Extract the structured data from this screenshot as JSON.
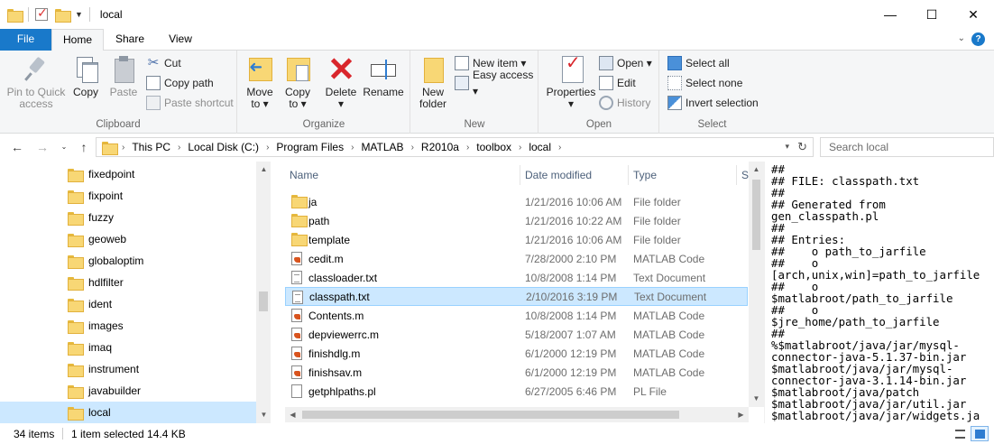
{
  "window": {
    "title": "local",
    "controls": {
      "minimize": "—",
      "maximize": "☐",
      "close": "✕"
    }
  },
  "ribbon": {
    "tabs": [
      "File",
      "Home",
      "Share",
      "View"
    ],
    "active_tab": "Home",
    "help": "?",
    "clipboard": {
      "label": "Clipboard",
      "pin": [
        "Pin to Quick",
        "access"
      ],
      "copy": "Copy",
      "paste": "Paste",
      "cut": "Cut",
      "copy_path": "Copy path",
      "paste_shortcut": "Paste shortcut"
    },
    "organize": {
      "label": "Organize",
      "move_to": [
        "Move",
        "to ▾"
      ],
      "copy_to": [
        "Copy",
        "to ▾"
      ],
      "delete": [
        "Delete",
        "▾"
      ],
      "rename": "Rename"
    },
    "new": {
      "label": "New",
      "new_folder": [
        "New",
        "folder"
      ],
      "new_item": "New item ▾",
      "easy_access": "Easy access ▾"
    },
    "open": {
      "label": "Open",
      "properties": [
        "Properties",
        "▾"
      ],
      "open": "Open ▾",
      "edit": "Edit",
      "history": "History"
    },
    "select": {
      "label": "Select",
      "select_all": "Select all",
      "select_none": "Select none",
      "invert_selection": "Invert selection"
    }
  },
  "address": {
    "breadcrumbs": [
      "This PC",
      "Local Disk (C:)",
      "Program Files",
      "MATLAB",
      "R2010a",
      "toolbox",
      "local"
    ],
    "search_placeholder": "Search local"
  },
  "nav_pane": {
    "items": [
      "fixedpoint",
      "fixpoint",
      "fuzzy",
      "geoweb",
      "globaloptim",
      "hdlfilter",
      "ident",
      "images",
      "imaq",
      "instrument",
      "javabuilder",
      "local"
    ],
    "selected": "local"
  },
  "file_list": {
    "columns": {
      "name": "Name",
      "date": "Date modified",
      "type": "Type",
      "size": "Si"
    },
    "rows": [
      {
        "name": "ja",
        "date": "1/21/2016 10:06 AM",
        "type": "File folder",
        "icon": "folder"
      },
      {
        "name": "path",
        "date": "1/21/2016 10:22 AM",
        "type": "File folder",
        "icon": "folder"
      },
      {
        "name": "template",
        "date": "1/21/2016 10:06 AM",
        "type": "File folder",
        "icon": "folder"
      },
      {
        "name": "cedit.m",
        "date": "7/28/2000 2:10 PM",
        "type": "MATLAB Code",
        "icon": "matlab"
      },
      {
        "name": "classloader.txt",
        "date": "10/8/2008 1:14 PM",
        "type": "Text Document",
        "icon": "text"
      },
      {
        "name": "classpath.txt",
        "date": "2/10/2016 3:19 PM",
        "type": "Text Document",
        "icon": "text",
        "selected": true
      },
      {
        "name": "Contents.m",
        "date": "10/8/2008 1:14 PM",
        "type": "MATLAB Code",
        "icon": "matlab"
      },
      {
        "name": "depviewerrc.m",
        "date": "5/18/2007 1:07 AM",
        "type": "MATLAB Code",
        "icon": "matlab"
      },
      {
        "name": "finishdlg.m",
        "date": "6/1/2000 12:19 PM",
        "type": "MATLAB Code",
        "icon": "matlab"
      },
      {
        "name": "finishsav.m",
        "date": "6/1/2000 12:19 PM",
        "type": "MATLAB Code",
        "icon": "matlab"
      },
      {
        "name": "getphlpaths.pl",
        "date": "6/27/2005 6:46 PM",
        "type": "PL File",
        "icon": "doc"
      }
    ]
  },
  "preview": {
    "lines": [
      "##",
      "## FILE: classpath.txt",
      "##",
      "## Generated from",
      "gen_classpath.pl",
      "##",
      "## Entries:",
      "##    o path_to_jarfile",
      "##    o",
      "[arch,unix,win]=path_to_jarfile",
      "##    o",
      "$matlabroot/path_to_jarfile",
      "##    o",
      "$jre_home/path_to_jarfile",
      "##",
      "%$matlabroot/java/jar/mysql-",
      "connector-java-5.1.37-bin.jar",
      "$matlabroot/java/jar/mysql-",
      "connector-java-3.1.14-bin.jar",
      "$matlabroot/java/patch",
      "$matlabroot/java/jar/util.jar",
      "$matlabroot/java/jar/widgets.ja"
    ]
  },
  "status": {
    "item_count": "34 items",
    "selection": "1 item selected  14.4 KB"
  }
}
